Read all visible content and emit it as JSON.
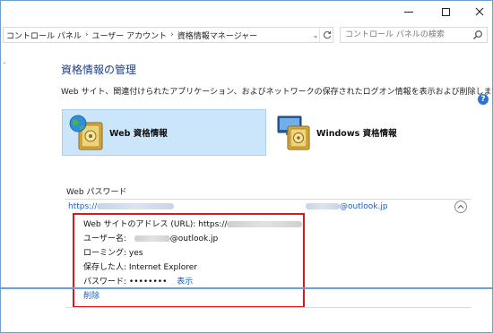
{
  "window": {
    "controls": {
      "minimize": "minimize",
      "maximize": "maximize",
      "close": "close"
    }
  },
  "address": {
    "crumbs": [
      "コントロール パネル",
      "ユーザー アカウント",
      "資格情報マネージャー"
    ],
    "search_placeholder": "コントロール パネルの検索"
  },
  "left_mark": "ˆ",
  "help_label": "?",
  "page": {
    "title": "資格情報の管理",
    "description": "Web サイト、関連付けられたアプリケーション、およびネットワークの保存されたログオン情報を表示および削除します。"
  },
  "tiles": {
    "web_label": "Web 資格情報",
    "windows_label": "Windows 資格情報"
  },
  "section": {
    "label": "Web パスワード"
  },
  "credential": {
    "url_prefix": "https://",
    "user_suffix": "@outlook.jp"
  },
  "details": {
    "url_key": "Web サイトのアドレス (URL):",
    "url_value_prefix": "https://",
    "user_key": "ユーザー名:",
    "user_value_suffix": "@outlook.jp",
    "roaming_key": "ローミング:",
    "roaming_value": "yes",
    "saved_by_key": "保存した人:",
    "saved_by_value": "Internet Explorer",
    "password_key": "パスワード:",
    "password_mask": "••••••••",
    "show_link": "表示",
    "delete_link": "削除"
  },
  "colors": {
    "accent": "#1d5eb8",
    "title": "#1e3f8a",
    "highlight_tile": "#cbe6fb",
    "emphasis_box": "#e4141b"
  }
}
